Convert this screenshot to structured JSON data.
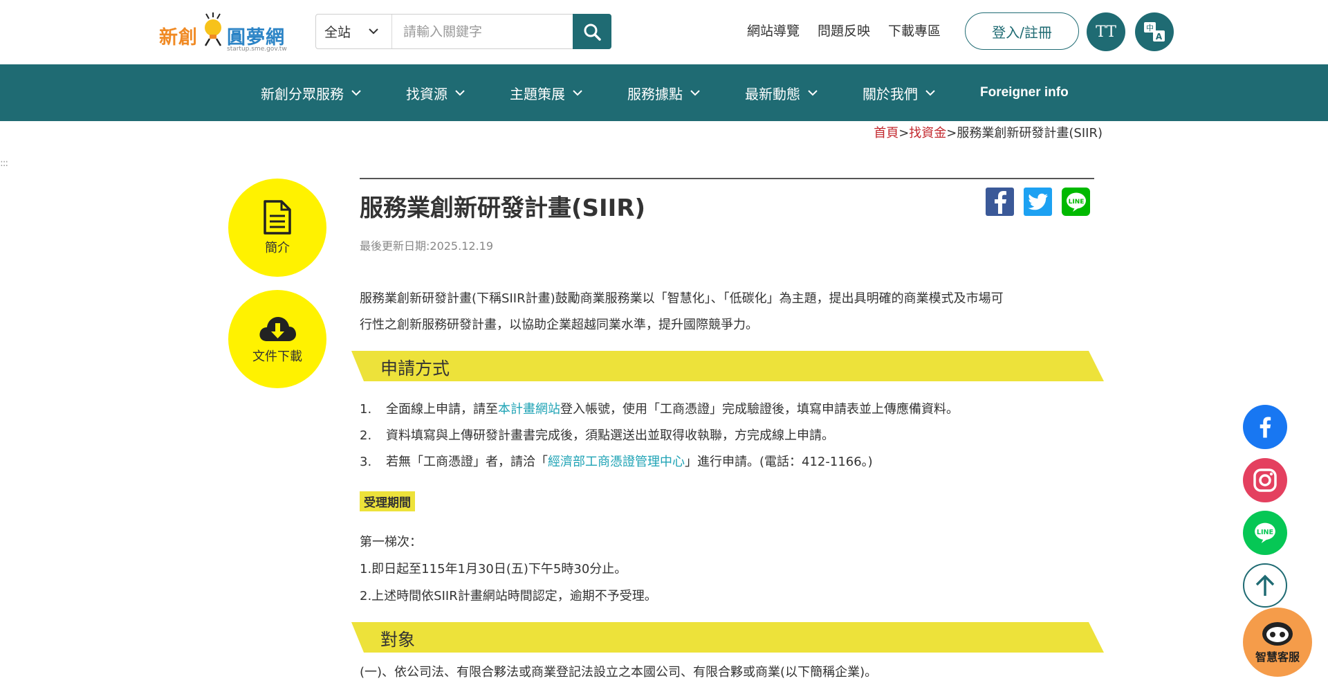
{
  "header": {
    "logo": {
      "part1": "新創",
      "part2": "圓夢網",
      "sub": "startup.sme.gov.tw"
    },
    "search": {
      "scope": "全站",
      "placeholder": "請輸入關鍵字"
    },
    "links": [
      "網站導覽",
      "問題反映",
      "下載專區"
    ],
    "login_label": "登入/註冊",
    "font_size_label": "TT"
  },
  "nav": {
    "items": [
      {
        "label": "新創分眾服務"
      },
      {
        "label": "找資源"
      },
      {
        "label": "主題策展"
      },
      {
        "label": "服務據點"
      },
      {
        "label": "最新動態"
      },
      {
        "label": "關於我們"
      }
    ],
    "foreign": "Foreigner info"
  },
  "breadcrumb": {
    "home": "首頁",
    "sep": ">",
    "parent": "找資金",
    "current": "服務業創新研發計畫(SIIR)"
  },
  "side": {
    "intro": "簡介",
    "download": "文件下載"
  },
  "page": {
    "title": "服務業創新研發計畫(SIIR)",
    "updated": "最後更新日期:2025.12.19",
    "intro_line1": "服務業創新研發計畫(下稱SIIR計畫)鼓勵商業服務業以「智慧化」、「低碳化」為主題，提出具明確的商業模式及市場可",
    "intro_line2": "行性之創新服務研發計畫，以協助企業超越同業水準，提升國際競爭力。",
    "section1": "申請方式",
    "steps": [
      {
        "num": "1.",
        "pre": "全面線上申請，請至",
        "link": "本計畫網站",
        "post": "登入帳號，使用「工商憑證」完成驗證後，填寫申請表並上傳應備資料。"
      },
      {
        "num": "2.",
        "pre": "資料填寫與上傳研發計畫書完成後，須點選送出並取得收執聯，方完成線上申請。",
        "link": "",
        "post": ""
      },
      {
        "num": "3.",
        "pre": "若無「工商憑證」者，請洽「",
        "link": "經濟部工商憑證管理中心",
        "post": "」進行申請。(電話：412-1166。)"
      }
    ],
    "period_label": "受理期間",
    "period_lines": [
      "第一梯次：",
      "1.即日起至115年1月30日(五)下午5時30分止。",
      "2.上述時間依SIIR計畫網站時間認定，逾期不予受理。"
    ],
    "section2": "對象",
    "target_line": "(一)、依公司法、有限合夥法或商業登記法設立之本國公司、有限合夥或商業(以下簡稱企業)。"
  },
  "floating": {
    "bot_label": "智慧客服"
  },
  "colors": {
    "primary": "#1f6b73",
    "yellow": "#fff200",
    "section": "#ede23a",
    "link": "#1fa3b5",
    "crumb": "#c2272d"
  }
}
